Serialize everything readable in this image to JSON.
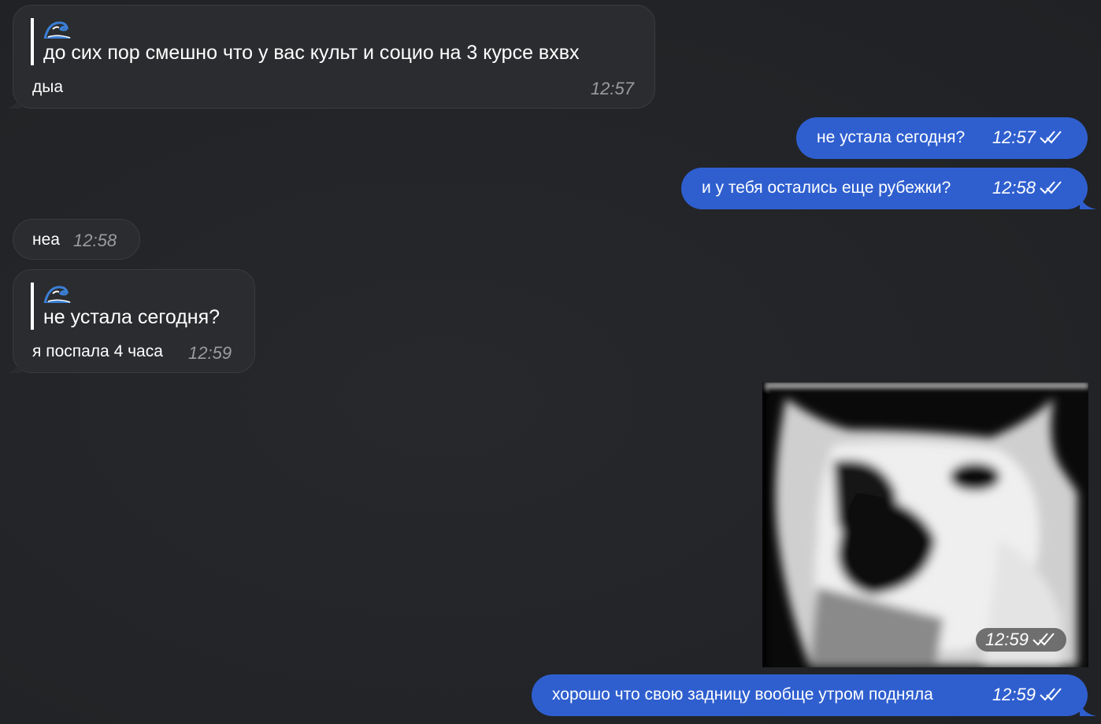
{
  "messages": [
    {
      "direction": "incoming",
      "reply_emoji": "wave-emoji",
      "reply_text": "до сих пор смешно что у вас культ и социо на 3 курсе вхвх",
      "text": "дыа",
      "time": "12:57"
    },
    {
      "direction": "outgoing",
      "text": "не устала сегодня?",
      "time": "12:57",
      "status": "read"
    },
    {
      "direction": "outgoing",
      "text": "и у тебя остались еще рубежки?",
      "time": "12:58",
      "status": "read"
    },
    {
      "direction": "incoming",
      "text": "неа",
      "time": "12:58"
    },
    {
      "direction": "incoming",
      "reply_emoji": "wave-emoji",
      "reply_text": "не устала сегодня?",
      "text": "я поспала 4 часа",
      "time": "12:59"
    },
    {
      "direction": "outgoing",
      "type": "photo",
      "photo_subject": "cat-photo",
      "time": "12:59",
      "status": "read"
    },
    {
      "direction": "outgoing",
      "text": "хорошо что свою задницу вообще утром подняла",
      "time": "12:59",
      "status": "read"
    }
  ],
  "colors": {
    "background": "#222427",
    "incoming_bubble": "#2b2c2f",
    "outgoing_bubble": "#2f5fcf",
    "time_incoming": "#9a9ca0",
    "time_outgoing": "#ffffff"
  }
}
